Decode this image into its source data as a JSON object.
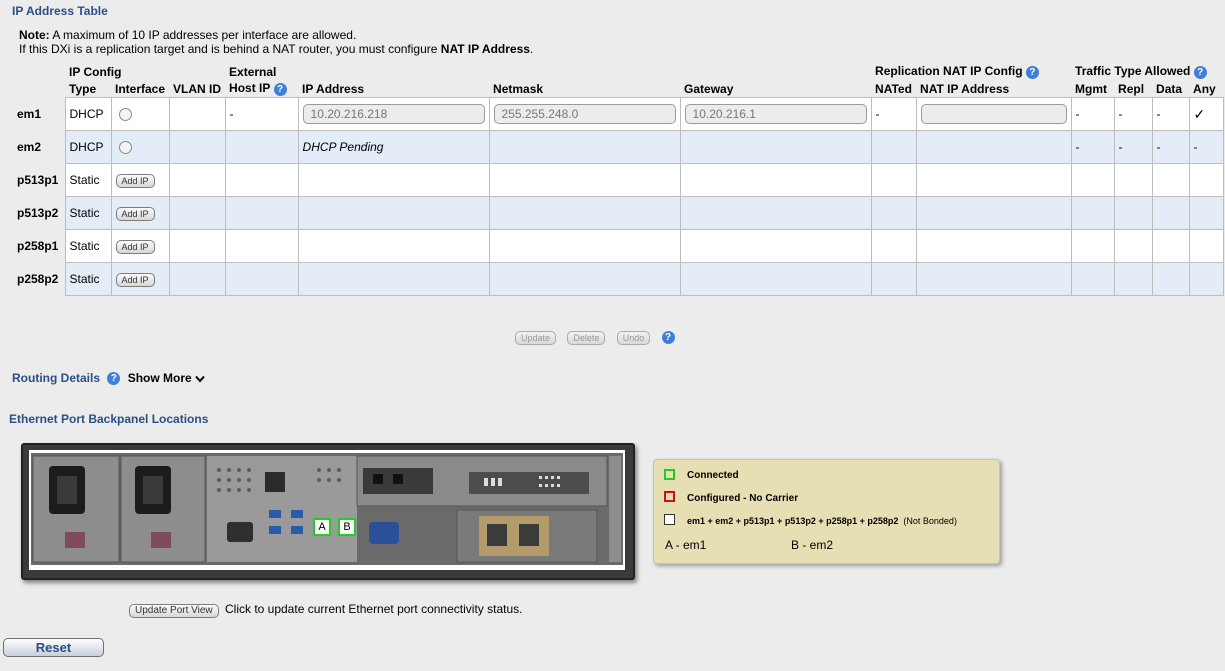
{
  "ip_table": {
    "title": "IP Address Table",
    "note_label": "Note:",
    "note_line1": " A maximum of 10 IP addresses per interface are allowed.",
    "note_line2_pre": "If this DXi is a replication target and is behind a NAT router, you must configure ",
    "note_line2_bold": "NAT IP Address",
    "note_line2_post": ".",
    "header": {
      "ip_config": "IP Config",
      "external": "External",
      "replication_nat": "Replication NAT IP Config",
      "traffic_type": "Traffic Type Allowed",
      "type": "Type",
      "interface": "Interface",
      "vlan_id": "VLAN ID",
      "host_ip": "Host IP",
      "ip_address": "IP Address",
      "netmask": "Netmask",
      "gateway": "Gateway",
      "nated": "NATed",
      "nat_ip": "NAT IP Address",
      "mgmt": "Mgmt",
      "repl": "Repl",
      "data": "Data",
      "any": "Any"
    },
    "rows": [
      {
        "iface": "em1",
        "type": "DHCP",
        "host_ip": "-",
        "ip": "10.20.216.218",
        "netmask": "255.255.248.0",
        "gateway": "10.20.216.1",
        "nated": "-",
        "mgmt": "-",
        "repl": "-",
        "data": "-",
        "any": "✓"
      },
      {
        "iface": "em2",
        "type": "DHCP",
        "ip_status": "DHCP Pending",
        "mgmt": "-",
        "repl": "-",
        "data": "-",
        "any": "-"
      },
      {
        "iface": "p513p1",
        "type": "Static",
        "add_ip": "Add IP"
      },
      {
        "iface": "p513p2",
        "type": "Static",
        "add_ip": "Add IP"
      },
      {
        "iface": "p258p1",
        "type": "Static",
        "add_ip": "Add IP"
      },
      {
        "iface": "p258p2",
        "type": "Static",
        "add_ip": "Add IP"
      }
    ],
    "buttons": {
      "update": "Update",
      "delete": "Delete",
      "undo": "Undo"
    }
  },
  "routing": {
    "title": "Routing Details",
    "show_more": "Show More"
  },
  "backpanel": {
    "title": "Ethernet Port Backpanel Locations",
    "port_a": "A",
    "port_b": "B",
    "legend": {
      "connected": "Connected",
      "no_carrier": "Configured - No Carrier",
      "ports": "em1 + em2 + p513p1 + p513p2 + p258p1 + p258p2",
      "not_bonded": "(Not Bonded)",
      "a_map": "A - em1",
      "b_map": "B - em2"
    },
    "colors": {
      "connected": "#22cc22",
      "no_carrier": "#cc1111"
    },
    "update_button": "Update Port View",
    "update_text": "Click to update current Ethernet port connectivity status."
  },
  "reset_label": "Reset",
  "icons": {
    "help": "question-circle-icon",
    "chevron": "chevron-down-icon",
    "check": "check-icon",
    "radio": "radio-icon"
  }
}
